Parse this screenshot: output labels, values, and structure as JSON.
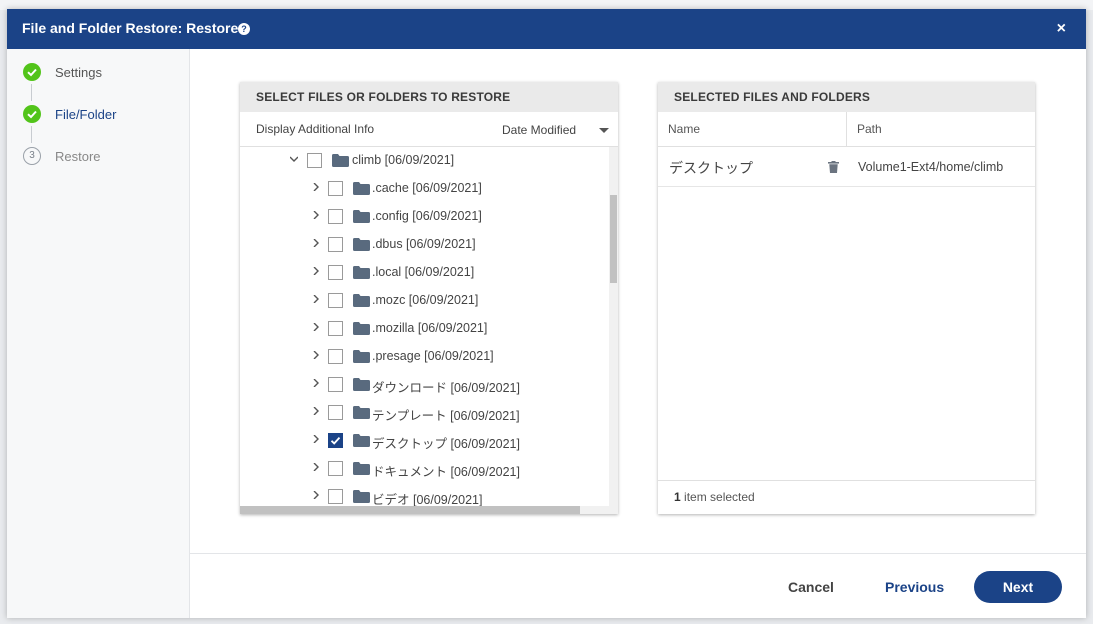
{
  "dialog": {
    "title": "File and Folder Restore: Restore",
    "help_icon": "question-circle-icon",
    "close_label": "×"
  },
  "wizard": {
    "steps": [
      {
        "label": "Settings",
        "state": "complete"
      },
      {
        "label": "File/Folder",
        "state": "active"
      },
      {
        "label": "Restore",
        "state": "pending",
        "number": "3"
      }
    ]
  },
  "left_panel": {
    "header": "SELECT FILES OR FOLDERS TO RESTORE",
    "info_label": "Display Additional Info",
    "sort_value": "Date Modified",
    "tree": [
      {
        "label": "climb [06/09/2021]",
        "level": 0,
        "expanded": true,
        "checked": false
      },
      {
        "label": ".cache [06/09/2021]",
        "level": 1,
        "expanded": false,
        "checked": false
      },
      {
        "label": ".config [06/09/2021]",
        "level": 1,
        "expanded": false,
        "checked": false
      },
      {
        "label": ".dbus [06/09/2021]",
        "level": 1,
        "expanded": false,
        "checked": false
      },
      {
        "label": ".local [06/09/2021]",
        "level": 1,
        "expanded": false,
        "checked": false
      },
      {
        "label": ".mozc [06/09/2021]",
        "level": 1,
        "expanded": false,
        "checked": false
      },
      {
        "label": ".mozilla [06/09/2021]",
        "level": 1,
        "expanded": false,
        "checked": false
      },
      {
        "label": ".presage [06/09/2021]",
        "level": 1,
        "expanded": false,
        "checked": false
      },
      {
        "label": "ダウンロード [06/09/2021]",
        "level": 1,
        "expanded": false,
        "checked": false
      },
      {
        "label": "テンプレート [06/09/2021]",
        "level": 1,
        "expanded": false,
        "checked": false
      },
      {
        "label": "デスクトップ [06/09/2021]",
        "level": 1,
        "expanded": false,
        "checked": true
      },
      {
        "label": "ドキュメント [06/09/2021]",
        "level": 1,
        "expanded": false,
        "checked": false
      },
      {
        "label": "ビデオ [06/09/2021]",
        "level": 1,
        "expanded": false,
        "checked": false
      }
    ]
  },
  "right_panel": {
    "header": "SELECTED FILES AND FOLDERS",
    "col_name": "Name",
    "col_path": "Path",
    "rows": [
      {
        "name": "デスクトップ",
        "path": "Volume1-Ext4/home/climb"
      }
    ],
    "count": "1",
    "count_suffix": " item selected"
  },
  "footer": {
    "cancel": "Cancel",
    "previous": "Previous",
    "next": "Next"
  },
  "colors": {
    "primary": "#1b4387",
    "success": "#52c41a"
  }
}
